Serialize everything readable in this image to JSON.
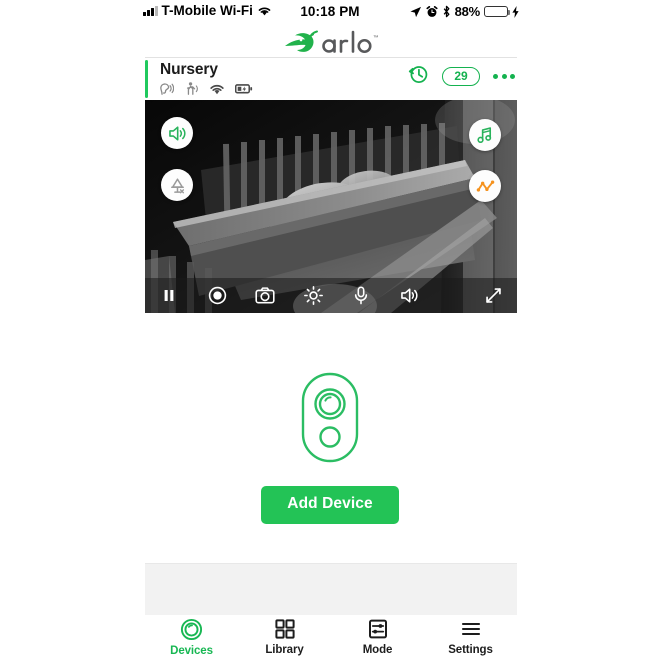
{
  "status_bar": {
    "carrier": "T-Mobile Wi-Fi",
    "time": "10:18 PM",
    "battery_percent": "88%",
    "icons": [
      "signal-bars-icon",
      "wifi-icon",
      "location-arrow-icon",
      "alarm-clock-icon",
      "bluetooth-icon",
      "battery-icon",
      "charging-bolt-icon"
    ]
  },
  "brand": {
    "name": "arlo",
    "trademark": "™",
    "logo_icon": "arlo-bird-logo-icon",
    "accent_color": "#21b24b",
    "wordmark_color": "#58595b"
  },
  "camera_card": {
    "title": "Nursery",
    "accent_color": "#20c95e",
    "status_icons": [
      "audio-detection-icon",
      "motion-detection-icon",
      "wifi-signal-icon",
      "battery-charging-icon"
    ],
    "actions": {
      "history_icon": "clock-rewind-icon",
      "badge_count": "29",
      "more_icon": "more-options-icon"
    },
    "overlay_buttons": [
      {
        "name": "speaker-button",
        "icon": "speaker-on-icon",
        "color": "#29b35c"
      },
      {
        "name": "night-light-button",
        "icon": "lamp-off-icon",
        "color": "#9a9a9a"
      },
      {
        "name": "music-button",
        "icon": "music-note-icon",
        "color": "#29b35c"
      },
      {
        "name": "sensor-chart-button",
        "icon": "line-chart-icon",
        "color": "#f5921e"
      }
    ],
    "controls": [
      {
        "name": "pause-button",
        "icon": "pause-icon"
      },
      {
        "name": "record-button",
        "icon": "record-icon"
      },
      {
        "name": "snapshot-button",
        "icon": "camera-icon"
      },
      {
        "name": "brightness-button",
        "icon": "brightness-sun-icon"
      },
      {
        "name": "microphone-button",
        "icon": "microphone-icon"
      },
      {
        "name": "volume-button",
        "icon": "volume-icon"
      },
      {
        "name": "fullscreen-button",
        "icon": "expand-arrows-icon"
      }
    ]
  },
  "add_device": {
    "device_icon": "arlo-camera-device-icon",
    "button_label": "Add Device",
    "button_color": "#23c356"
  },
  "tabbar": {
    "items": [
      {
        "label": "Devices",
        "icon": "camera-lens-icon",
        "active": true
      },
      {
        "label": "Library",
        "icon": "grid-squares-icon",
        "active": false
      },
      {
        "label": "Mode",
        "icon": "sliders-box-icon",
        "active": false
      },
      {
        "label": "Settings",
        "icon": "hamburger-lines-icon",
        "active": false
      }
    ],
    "active_color": "#18b753"
  }
}
